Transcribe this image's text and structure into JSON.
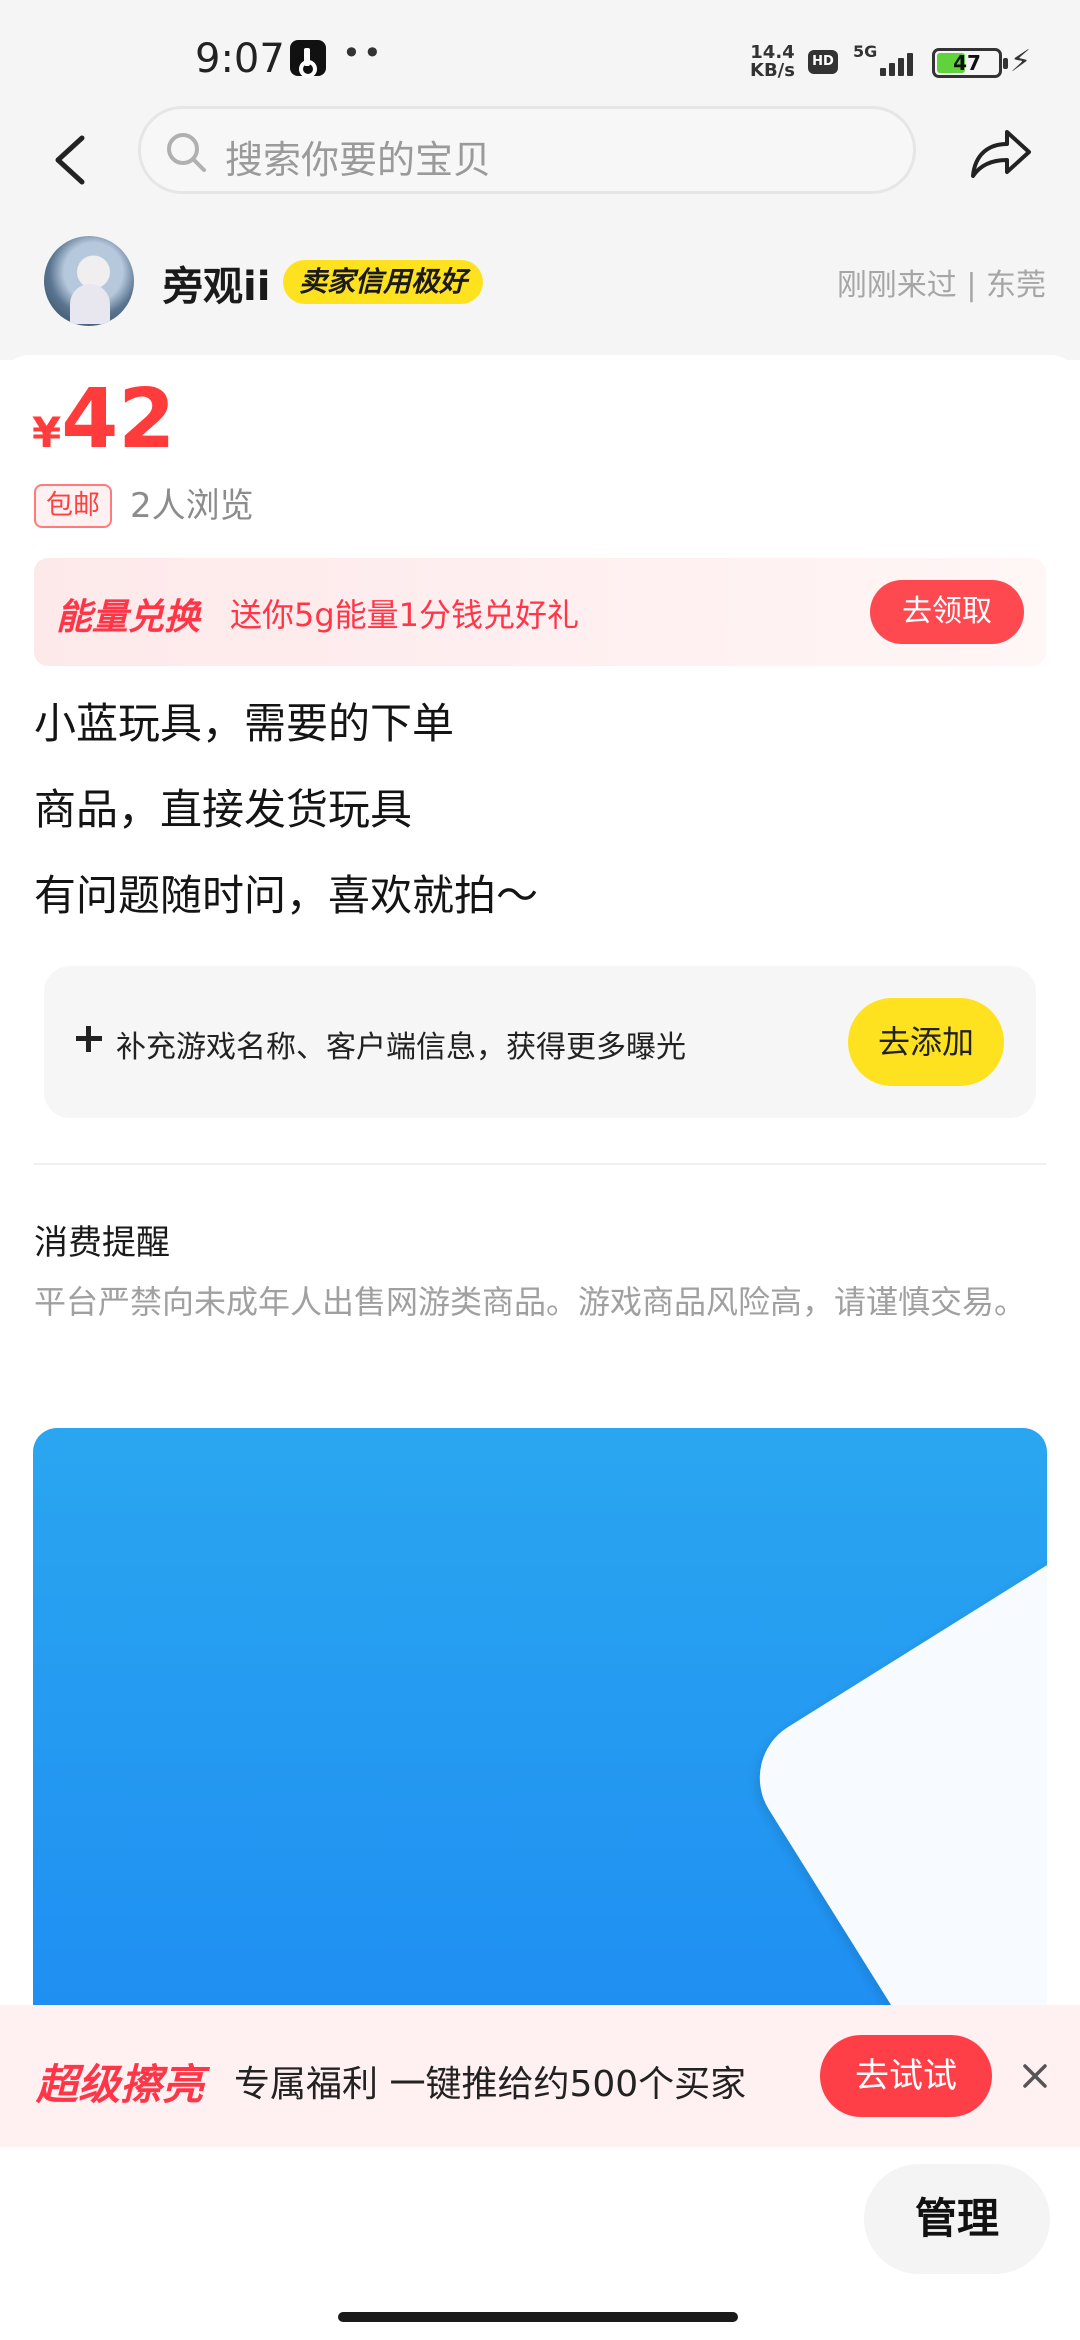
{
  "status_bar": {
    "time": "9:07",
    "dots": "••",
    "net_speed": "14.4",
    "net_unit": "KB/s",
    "hd_label": "HD",
    "network_type": "5G",
    "battery_level": "47",
    "app_icon": "tiktok-icon",
    "charge_icon": "bolt-icon"
  },
  "nav": {
    "back_icon": "chevron-left-icon",
    "search_placeholder": "搜索你要的宝贝",
    "share_icon": "share-arrow-icon"
  },
  "seller": {
    "name": "旁观ii",
    "credit_badge": "卖家信用极好",
    "last_seen_location": "刚刚来过 | 东莞"
  },
  "product": {
    "currency_symbol": "¥",
    "price": "42",
    "shipping_tag": "包邮",
    "views": "2人浏览",
    "description_lines": [
      "小蓝玩具，需要的下单",
      "商品，直接发货玩具",
      "有问题随时问，喜欢就拍～"
    ]
  },
  "energy_banner": {
    "title": "能量兑换",
    "text": "送你5g能量1分钱兑好礼",
    "button": "去领取"
  },
  "add_info": {
    "text": "补充游戏名称、客户端信息，获得更多曝光",
    "button": "去添加"
  },
  "notice": {
    "title": "消费提醒",
    "body": "平台严禁向未成年人出售网游类商品。游戏商品风险高，请谨慎交易。"
  },
  "promo": {
    "title": "超级擦亮",
    "text": "专属福利 一键推给约500个买家",
    "button": "去试试",
    "close_icon": "close-icon"
  },
  "actions": {
    "manage": "管理"
  },
  "colors": {
    "accent_red": "#ff3b3b",
    "accent_yellow": "#ffe21f",
    "page_bg": "#f5f5f5"
  }
}
